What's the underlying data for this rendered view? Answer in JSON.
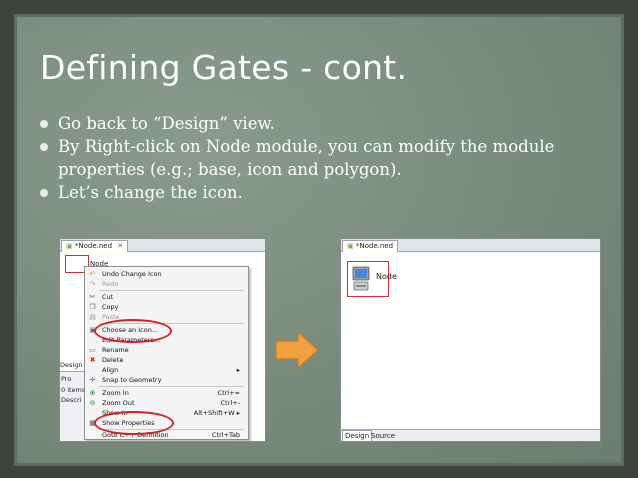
{
  "slide": {
    "title": "Defining Gates - cont.",
    "bullets": [
      "Go back to “Design” view.",
      "By Right-click on Node module, you can modify the module properties (e.g.; base, icon and polygon).",
      "Let’s change the icon."
    ]
  },
  "left_screenshot": {
    "tab_title": "*Node.ned",
    "node_label": "Node",
    "menu": [
      {
        "label": "Undo Change Icon",
        "shortcut": "",
        "icon": "undo-icon",
        "disabled": false
      },
      {
        "label": "Redo",
        "shortcut": "",
        "icon": "redo-icon",
        "disabled": true
      },
      {
        "label": "Cut",
        "shortcut": "",
        "icon": "cut-icon",
        "disabled": false
      },
      {
        "label": "Copy",
        "shortcut": "",
        "icon": "copy-icon",
        "disabled": false
      },
      {
        "label": "Paste",
        "shortcut": "",
        "icon": "paste-icon",
        "disabled": true
      },
      {
        "label": "Choose an Icon...",
        "shortcut": "",
        "icon": "choose-icon-icon",
        "disabled": false
      },
      {
        "label": "Edit Parameters...",
        "shortcut": "",
        "icon": "",
        "disabled": false
      },
      {
        "label": "Rename",
        "shortcut": "",
        "icon": "rename-icon",
        "disabled": false
      },
      {
        "label": "Delete",
        "shortcut": "",
        "icon": "delete-icon",
        "disabled": false
      },
      {
        "label": "Align",
        "shortcut": "▸",
        "icon": "",
        "disabled": false
      },
      {
        "label": "Snap to Geometry",
        "shortcut": "",
        "icon": "snap-icon",
        "disabled": false
      },
      {
        "label": "Zoom In",
        "shortcut": "Ctrl+=",
        "icon": "zoom-in-icon",
        "disabled": false
      },
      {
        "label": "Zoom Out",
        "shortcut": "Ctrl+-",
        "icon": "zoom-out-icon",
        "disabled": false
      },
      {
        "label": "Show In",
        "shortcut": "Alt+Shift+W ▸",
        "icon": "",
        "disabled": false
      },
      {
        "label": "Show Properties",
        "shortcut": "",
        "icon": "properties-icon",
        "disabled": false
      },
      {
        "label": "Goto C++ Definition",
        "shortcut": "Ctrl+Tab",
        "icon": "",
        "disabled": false
      }
    ],
    "lower_panel": {
      "design_label": "Design",
      "items": [
        "Pro",
        "0 items",
        "Descri"
      ]
    }
  },
  "right_screenshot": {
    "tab_title": "*Node.ned",
    "node_label": "Node",
    "bottom_tabs": [
      "Design",
      "Source"
    ]
  },
  "colors": {
    "accent_arrow": "#f0a040",
    "highlight_ellipse": "#d42020",
    "slide_background": "#7b8d7f"
  }
}
